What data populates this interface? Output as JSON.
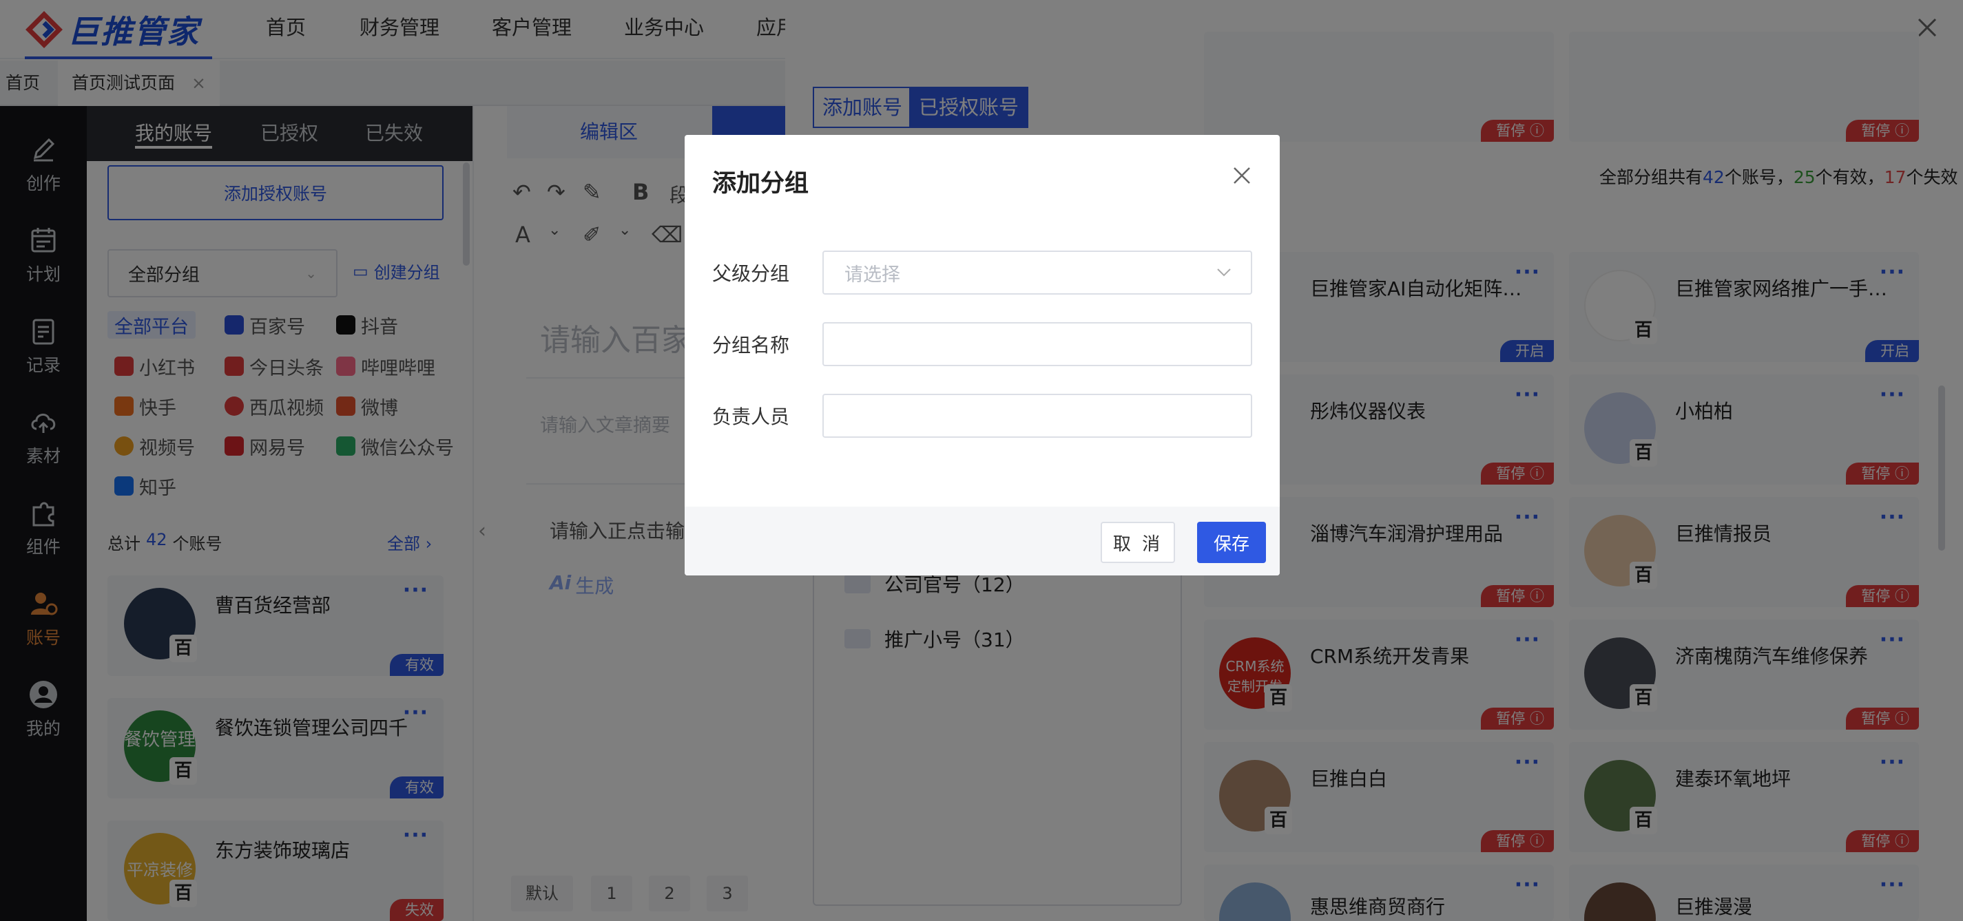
{
  "brand": {
    "name": "巨推管家",
    "color": "#2f59e3"
  },
  "nav": {
    "items": [
      "首页",
      "财务管理",
      "客户管理",
      "业务中心",
      "应用"
    ]
  },
  "tabs": {
    "home": "首页",
    "active": "首页测试页面",
    "close": "×"
  },
  "leftbar": {
    "items": [
      {
        "label": "创作",
        "icon": "pencil-icon"
      },
      {
        "label": "计划",
        "icon": "calendar-icon"
      },
      {
        "label": "记录",
        "icon": "clipboard-icon"
      },
      {
        "label": "素材",
        "icon": "cloud-upload-icon"
      },
      {
        "label": "组件",
        "icon": "puzzle-icon"
      },
      {
        "label": "账号",
        "icon": "account-icon"
      },
      {
        "label": "我的",
        "icon": "user-icon"
      }
    ]
  },
  "accounts": {
    "tabs": [
      "我的账号",
      "已授权",
      "已失效"
    ],
    "add_button": "添加授权账号",
    "group_select": "全部分组",
    "create_group": "创建分组",
    "platforms": [
      "全部平台",
      "百家号",
      "抖音",
      "小红书",
      "今日头条",
      "哔哩哔哩",
      "快手",
      "西瓜视频",
      "微博",
      "视频号",
      "网易号",
      "微信公众号",
      "知乎"
    ],
    "total_prefix": "总计",
    "total_count": "42",
    "total_suffix": "个账号",
    "all_link": "全部",
    "list": [
      {
        "name": "曹百货经营部",
        "status": "有效"
      },
      {
        "name": "餐饮连锁管理公司四千",
        "status": "有效"
      },
      {
        "name": "东方装饰玻璃店",
        "status": "失效"
      }
    ]
  },
  "editor": {
    "tab_label": "编辑区",
    "title_placeholder": "请输入百家",
    "summary_placeholder": "请输入文章摘要",
    "body_placeholder": "请输入正点击输",
    "ai_label": "生成",
    "pager": [
      "默认",
      "1",
      "2",
      "3"
    ]
  },
  "drawer": {
    "seg_add": "添加账号",
    "seg_auth": "已授权账号",
    "summary": {
      "p1": "全部分组共有",
      "total": "42",
      "p2": "个账号，",
      "valid": "25",
      "p3": "个有效，",
      "invalid": "17",
      "p4": "个失效"
    },
    "groups": [
      "公司官号（12）",
      "推广小号（31）"
    ],
    "cards": [
      {
        "name": "",
        "status": "暂停"
      },
      {
        "name": "",
        "status": "暂停"
      },
      {
        "name": "巨推管家AI自动化矩阵营销",
        "status": "开启"
      },
      {
        "name": "巨推管家网络推广一手资源",
        "status": "开启"
      },
      {
        "name": "彤炜仪器仪表",
        "status": "暂停"
      },
      {
        "name": "小柏柏",
        "status": "暂停"
      },
      {
        "name": "淄博汽车润滑护理用品",
        "status": "暂停"
      },
      {
        "name": "巨推情报员",
        "status": "暂停"
      },
      {
        "name": "CRM系统开发青果",
        "status": "暂停"
      },
      {
        "name": "济南槐荫汽车维修保养",
        "status": "暂停"
      },
      {
        "name": "巨推白白",
        "status": "暂停"
      },
      {
        "name": "建泰环氧地坪",
        "status": "暂停"
      },
      {
        "name": "惠思维商贸商行",
        "status": ""
      },
      {
        "name": "巨推漫漫",
        "status": ""
      }
    ],
    "avatar_text": {
      "crm": "CRM系统定制开发",
      "food": "餐饮管理",
      "east": "平凉装修"
    }
  },
  "modal": {
    "title": "添加分组",
    "parent_label": "父级分组",
    "parent_placeholder": "请选择",
    "name_label": "分组名称",
    "owner_label": "负责人员",
    "cancel": "取 消",
    "save": "保存"
  },
  "bjh_mark": "百"
}
